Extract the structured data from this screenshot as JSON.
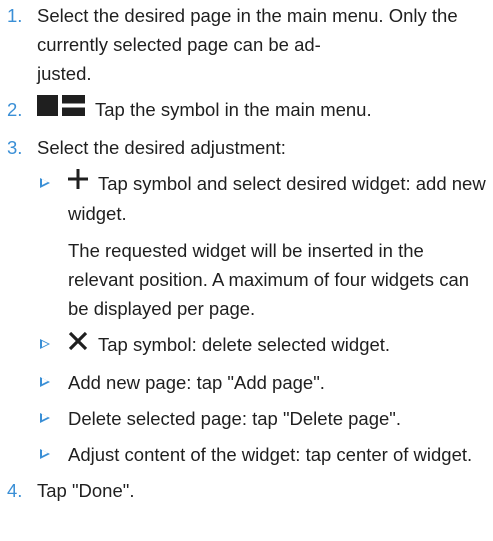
{
  "steps": [
    {
      "number": "1.",
      "text": "Select the desired page in the main menu. Only the currently selected page can be ad-justed."
    },
    {
      "number": "2.",
      "text": "Tap the symbol in the main menu.",
      "icon": "menu-icon"
    },
    {
      "number": "3.",
      "text": "Select the desired adjustment:",
      "items": [
        {
          "icon": "plus-icon",
          "text": "Tap symbol and select desired widget: add new widget.",
          "note": "The requested widget will be inserted in the relevant position. A maximum of four widgets can be displayed per page."
        },
        {
          "icon": "close-icon",
          "text": "Tap symbol: delete selected widget."
        },
        {
          "text": "Add new page: tap \"Add page\"."
        },
        {
          "text": "Delete selected page: tap \"Delete page\"."
        },
        {
          "text": "Adjust content of the widget: tap center of widget."
        }
      ]
    },
    {
      "number": "4.",
      "text": "Tap \"Done\"."
    }
  ],
  "colors": {
    "accent": "#3a8fd6",
    "text": "#1f1f1f"
  }
}
